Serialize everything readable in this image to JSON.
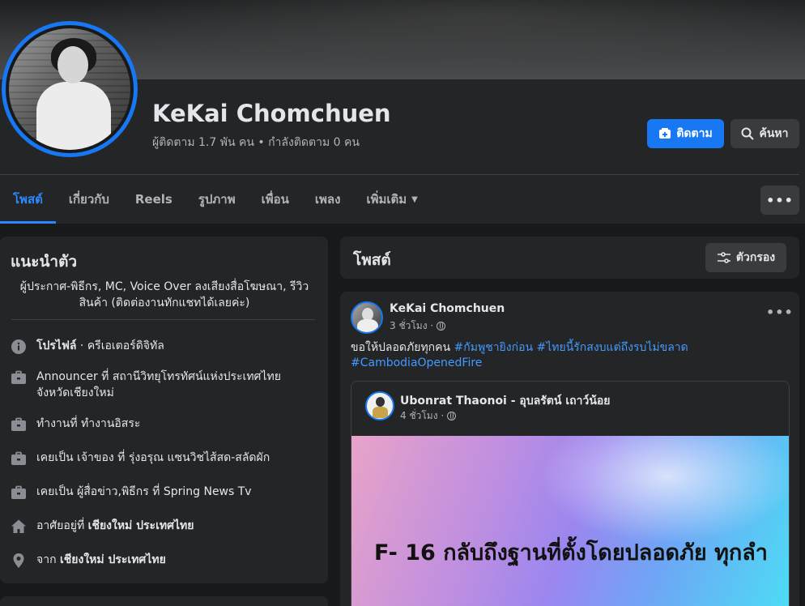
{
  "profile": {
    "name": "KeKai Chomchuen",
    "stats": "ผู้ติดตาม 1.7 พัน คน • กำลังติดตาม 0 คน",
    "follow_label": "ติดตาม",
    "search_label": "ค้นหา"
  },
  "tabs": [
    {
      "label": "โพสต์",
      "active": true
    },
    {
      "label": "เกี่ยวกับ"
    },
    {
      "label": "Reels"
    },
    {
      "label": "รูปภาพ"
    },
    {
      "label": "เพื่อน"
    },
    {
      "label": "เพลง"
    },
    {
      "label": "เพิ่มเติม"
    }
  ],
  "intro": {
    "title": "แนะนำตัว",
    "bio": "ผู้ประกาศ-พิธีกร, MC, Voice Over ลงเสียงสื่อโฆษณา, รีวิวสินค้า (ติดต่องานทักแชทได้เลยค่ะ)",
    "items": [
      {
        "icon": "info-icon",
        "bold": "โปรไฟล์",
        "text": " · ครีเอเตอร์ดิจิทัล"
      },
      {
        "icon": "briefcase-icon",
        "text": "Announcer ที่ สถานีวิทยุโทรทัศน์แห่งประเทศไทย จังหวัดเชียงใหม่"
      },
      {
        "icon": "briefcase-icon",
        "text": "ทำงานที่ ทำงานอิสระ"
      },
      {
        "icon": "briefcase-icon",
        "text": "เคยเป็น เจ้าของ ที่ รุ่งอรุณ แซนวิชไส้สด-สลัดผัก"
      },
      {
        "icon": "briefcase-icon",
        "text": "เคยเป็น ผู้สื่อข่าว,พิธีกร ที่ Spring News Tv"
      },
      {
        "icon": "home-icon",
        "text": "อาศัยอยู่ที่ ",
        "bold": "เชียงใหม่ ประเทศไทย"
      },
      {
        "icon": "location-icon",
        "text": "จาก ",
        "bold": "เชียงใหม่ ประเทศไทย"
      }
    ]
  },
  "posts": {
    "title": "โพสต์",
    "filter_label": "ตัวกรอง"
  },
  "post": {
    "author": "KeKai Chomchuen",
    "time": "3 ชั่วโมง ·",
    "text": "ขอให้ปลอดภัยทุกคน ",
    "tags": [
      "#กัมพูชายิงก่อน",
      "#ไทยนี้รักสงบแต่ถึงรบไม่ขลาด",
      "#CambodiaOpenedFire"
    ],
    "shared": {
      "author": "Ubonrat Thaonoi - อุบลรัตน์ เถาว์น้อย",
      "time": "4 ชั่วโมง ·",
      "image_text": "F- 16 กลับถึงฐานที่ตั้งโดยปลอดภัย ทุกลำ"
    }
  },
  "colors": {
    "accent": "#1877f2",
    "link": "#4599ff",
    "card": "#242526",
    "bg": "#18191a"
  }
}
